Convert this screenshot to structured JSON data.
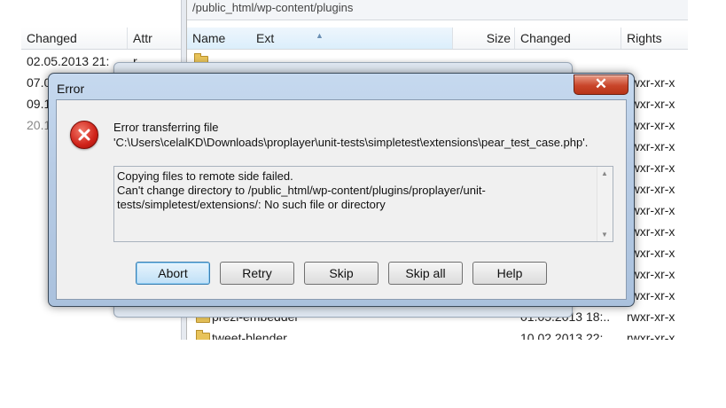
{
  "background": {
    "path_bar": "/public_html/wp-content/plugins",
    "left_panel": {
      "columns": [
        "Changed",
        "Attr"
      ],
      "rows": [
        {
          "changed": "02.05.2013  21:",
          "attr": "r"
        },
        {
          "changed": "07.0",
          "attr": ""
        },
        {
          "changed": "09.1",
          "attr": ""
        },
        {
          "changed": "20.1",
          "attr": ""
        }
      ]
    },
    "right_panel": {
      "columns": [
        "Name",
        "Ext",
        "Size",
        "Changed",
        "Rights"
      ],
      "rights_values": [
        "rwxr-xr-x",
        "rwxr-xr-x",
        "rwxr-xr-x",
        "rwxr-xr-x",
        "rwxr-xr-x",
        "rwxr-xr-x",
        "rwxr-xr-x",
        "rwxr-xr-x",
        "rwxr-xr-x",
        "rwxr-xr-x",
        "rwxr-xr-x"
      ],
      "bottom_rows": [
        {
          "name": "prezi-embedder",
          "changed": "01.05.2013 18:..",
          "rights": "rwxr-xr-x"
        },
        {
          "name": "tweet-blender",
          "changed": "10.02.2013 22:",
          "rights": "rwxr-xr-x"
        }
      ]
    }
  },
  "dialog": {
    "title": "Error",
    "close_label": "✕",
    "message_line1": "Error transferring file",
    "message_line2": "'C:\\Users\\celalKD\\Downloads\\proplayer\\unit-tests\\simpletest\\extensions\\pear_test_case.php'.",
    "details": {
      "line1": "Copying files to remote side failed.",
      "line2": "Can't change directory to /public_html/wp-content/plugins/proplayer/unit-",
      "line3": "tests/simpletest/extensions/: No such file or directory"
    },
    "buttons": {
      "abort": "Abort",
      "retry": "Retry",
      "skip": "Skip",
      "skip_all": "Skip all",
      "help": "Help"
    },
    "accent_color": "#c9452a"
  }
}
